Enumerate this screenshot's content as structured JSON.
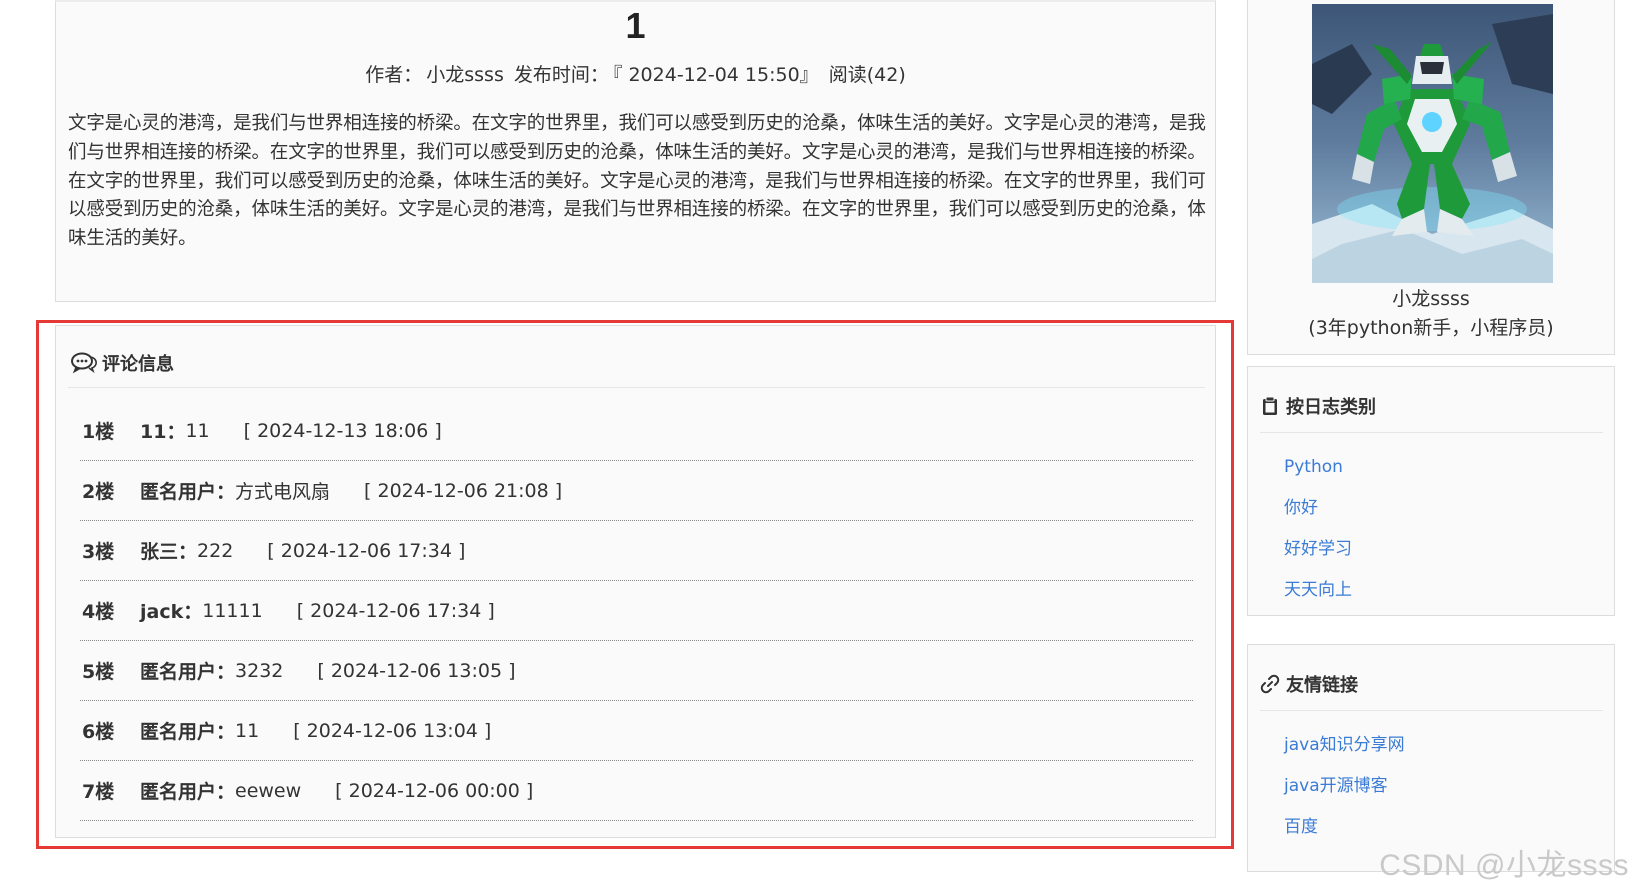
{
  "article": {
    "title": "1",
    "author_label": "作者：",
    "author": "小龙ssss",
    "published_label": "发布时间：",
    "published": "『 2024-12-04 15:50』",
    "reads": "阅读(42)",
    "body": "文字是心灵的港湾，是我们与世界相连接的桥梁。在文字的世界里，我们可以感受到历史的沧桑，体味生活的美好。文字是心灵的港湾，是我们与世界相连接的桥梁。在文字的世界里，我们可以感受到历史的沧桑，体味生活的美好。文字是心灵的港湾，是我们与世界相连接的桥梁。在文字的世界里，我们可以感受到历史的沧桑，体味生活的美好。文字是心灵的港湾，是我们与世界相连接的桥梁。在文字的世界里，我们可以感受到历史的沧桑，体味生活的美好。文字是心灵的港湾，是我们与世界相连接的桥梁。在文字的世界里，我们可以感受到历史的沧桑，体味生活的美好。"
  },
  "comments": {
    "title": "评论信息",
    "icon": "comment-icon",
    "highlight_color": "#e53935",
    "items": [
      {
        "floor": "1楼",
        "user": "11：",
        "text": "11",
        "date": "[ 2024-12-13 18:06 ]"
      },
      {
        "floor": "2楼",
        "user": "匿名用户：",
        "text": "方式电风扇",
        "date": "[ 2024-12-06 21:08 ]"
      },
      {
        "floor": "3楼",
        "user": "张三：",
        "text": "222",
        "date": "[ 2024-12-06 17:34 ]"
      },
      {
        "floor": "4楼",
        "user": "jack：",
        "text": "11111",
        "date": "[ 2024-12-06 17:34 ]"
      },
      {
        "floor": "5楼",
        "user": "匿名用户：",
        "text": "3232",
        "date": "[ 2024-12-06 13:05 ]"
      },
      {
        "floor": "6楼",
        "user": "匿名用户：",
        "text": "11",
        "date": "[ 2024-12-06 13:04 ]"
      },
      {
        "floor": "7楼",
        "user": "匿名用户：",
        "text": "eewew",
        "date": "[ 2024-12-06 00:00 ]"
      }
    ]
  },
  "sidebar": {
    "profile": {
      "name": "小龙ssss",
      "desc": "(3年python新手，小程序员)",
      "avatar_icon": "robot-avatar"
    },
    "categories": {
      "title": "按日志类别",
      "icon": "clipboard-icon",
      "items": [
        "Python",
        "你好",
        "好好学习",
        "天天向上"
      ]
    },
    "links": {
      "title": "友情链接",
      "icon": "link-icon",
      "items": [
        "java知识分享网",
        "java开源博客",
        "百度"
      ]
    }
  },
  "watermark": "CSDN @小龙ssss",
  "colors": {
    "link": "#3a7bd5",
    "panel_bg": "#fafafa",
    "border": "#dddddd"
  }
}
